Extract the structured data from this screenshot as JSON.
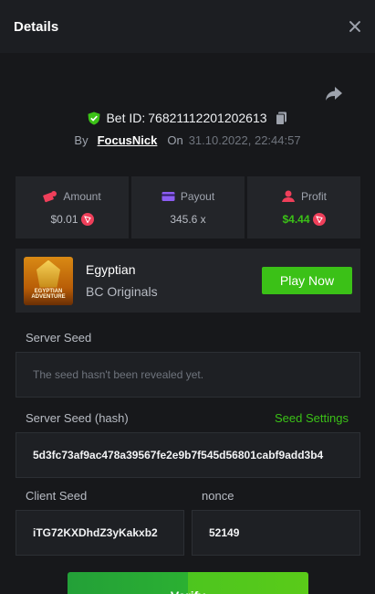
{
  "header": {
    "title": "Details"
  },
  "bet": {
    "id_label": "Bet ID:",
    "id": "76821112201202613",
    "by_label": "By",
    "user": "FocusNick",
    "on_label": "On",
    "datetime": "31.10.2022, 22:44:57"
  },
  "stats": {
    "amount": {
      "label": "Amount",
      "value": "$0.01"
    },
    "payout": {
      "label": "Payout",
      "value": "345.6 x"
    },
    "profit": {
      "label": "Profit",
      "value": "$4.44"
    }
  },
  "game": {
    "thumb_text": "EGYPTIAN ADVENTURE",
    "name": "Egyptian",
    "provider": "BC Originals",
    "play_label": "Play Now"
  },
  "seeds": {
    "server_seed_label": "Server Seed",
    "server_seed_value": "The seed hasn't been revealed yet.",
    "server_hash_label": "Server Seed (hash)",
    "seed_settings_label": "Seed Settings",
    "server_hash_value": "5d3fc73af9ac478a39567fe2e9b7f545d56801cabf9add3b4",
    "client_seed_label": "Client Seed",
    "client_seed_value": "iTG72KXDhdZ3yKakxb2",
    "nonce_label": "nonce",
    "nonce_value": "52149"
  },
  "verify_label": "Verify",
  "colors": {
    "accent": "#3bc117",
    "coin": "#ef3f5a",
    "background": "#17181b"
  }
}
